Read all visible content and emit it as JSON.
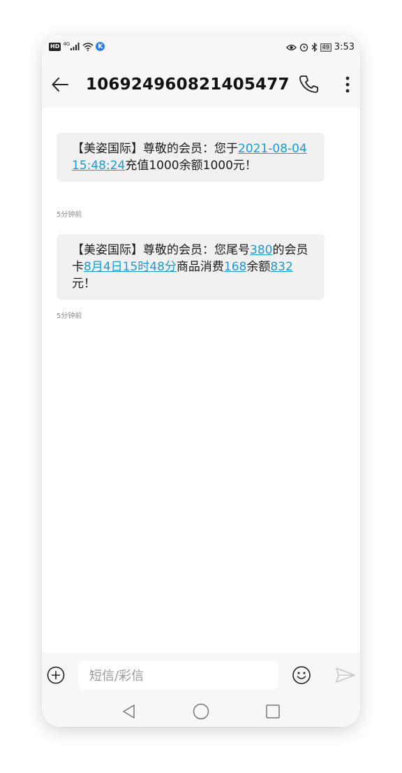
{
  "status_bar": {
    "network_label": "HD",
    "network_type": "4G",
    "app_badge": "K",
    "battery": "49",
    "time": "3:53"
  },
  "header": {
    "title": "106924960821405477",
    "back_icon": "arrow-left-icon",
    "call_icon": "phone-icon",
    "more_icon": "more-vertical-icon"
  },
  "messages": [
    {
      "parts": [
        {
          "text": "【美姿国际】尊敬的会员：您于"
        },
        {
          "text": "2021-08-04 15:48:24",
          "link": true
        },
        {
          "text": "充值1000余额1000元！"
        }
      ],
      "time": "5分钟前"
    },
    {
      "parts": [
        {
          "text": "【美姿国际】尊敬的会员：您尾号"
        },
        {
          "text": "380",
          "link": true
        },
        {
          "text": "的会员卡"
        },
        {
          "text": "8月4日15时48分",
          "link": true
        },
        {
          "text": "商品消费"
        },
        {
          "text": "168",
          "link": true
        },
        {
          "text": "余额"
        },
        {
          "text": "832",
          "link": true
        },
        {
          "text": "元！"
        }
      ],
      "time": "5分钟前"
    }
  ],
  "composer": {
    "placeholder": "短信/彩信",
    "add_icon": "plus-circle-icon",
    "emoji_icon": "smiley-icon",
    "send_icon": "send-icon"
  },
  "nav_bar": {
    "back_icon": "triangle-back-icon",
    "home_icon": "circle-home-icon",
    "recent_icon": "square-recents-icon"
  },
  "colors": {
    "link": "#1b9ad6",
    "bubble": "#f1f1f1",
    "chrome": "#f7f7f7"
  }
}
